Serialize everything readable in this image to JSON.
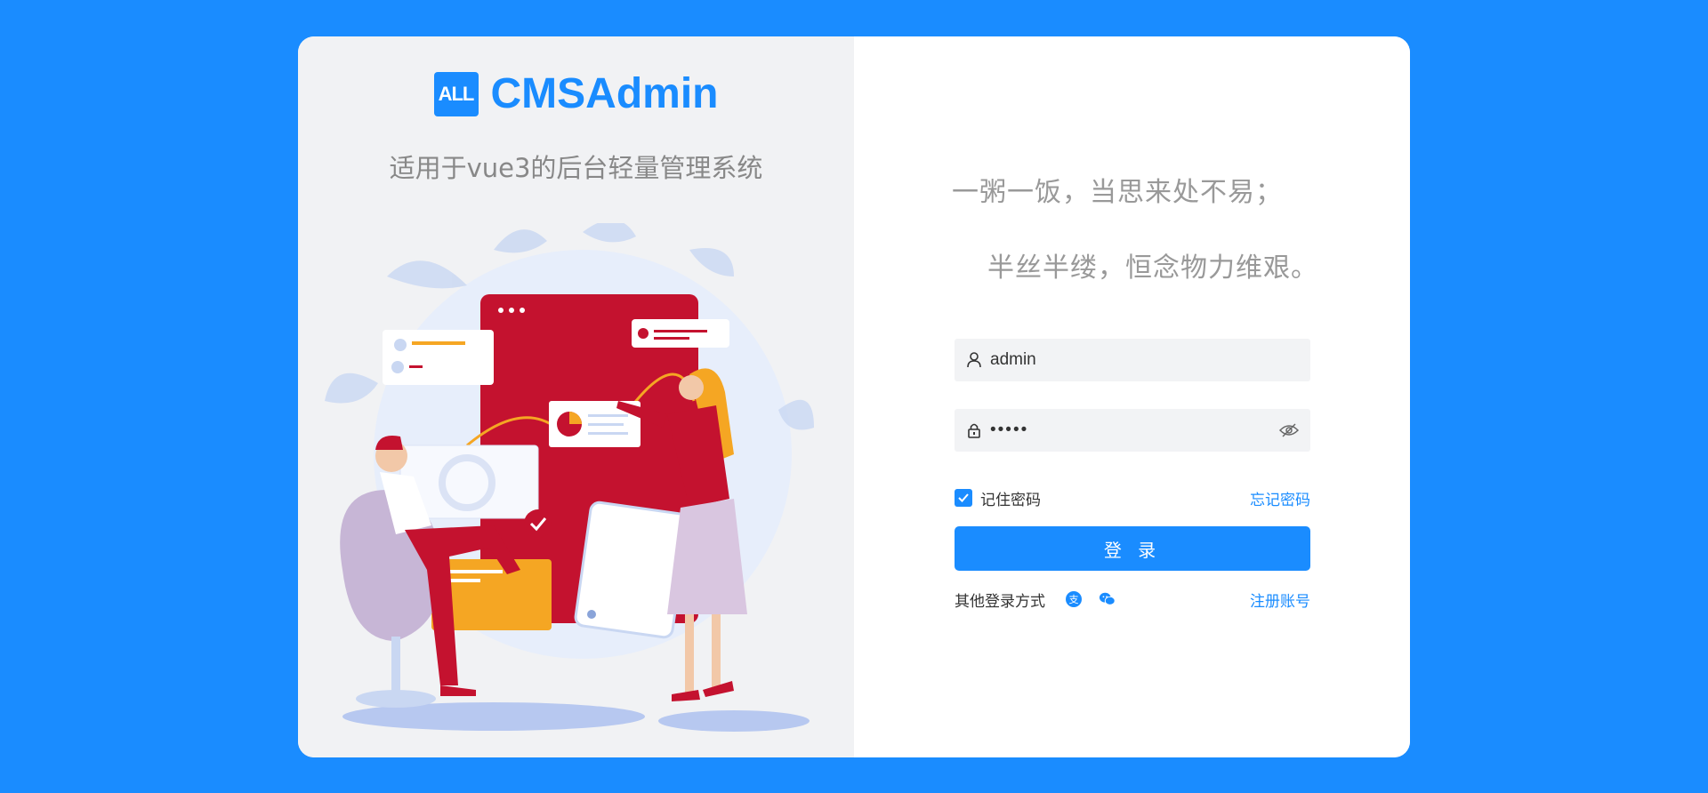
{
  "brand": {
    "logo_text": "ALL",
    "name": "CMSAdmin",
    "subtitle": "适用于vue3的后台轻量管理系统"
  },
  "poem": {
    "line1": "一粥一饭，当思来处不易；",
    "line2": "半丝半缕，恒念物力维艰。"
  },
  "form": {
    "username_value": "admin",
    "password_value": "•••••",
    "remember_label": "记住密码",
    "remember_checked": true,
    "forgot_label": "忘记密码",
    "login_label": "登 录",
    "other_login_label": "其他登录方式",
    "register_label": "注册账号",
    "social_icons": [
      "alipay-icon",
      "wechat-icon"
    ]
  },
  "colors": {
    "accent": "#1a8cff",
    "panel": "#f1f2f4",
    "illustration_red": "#c4122f"
  }
}
